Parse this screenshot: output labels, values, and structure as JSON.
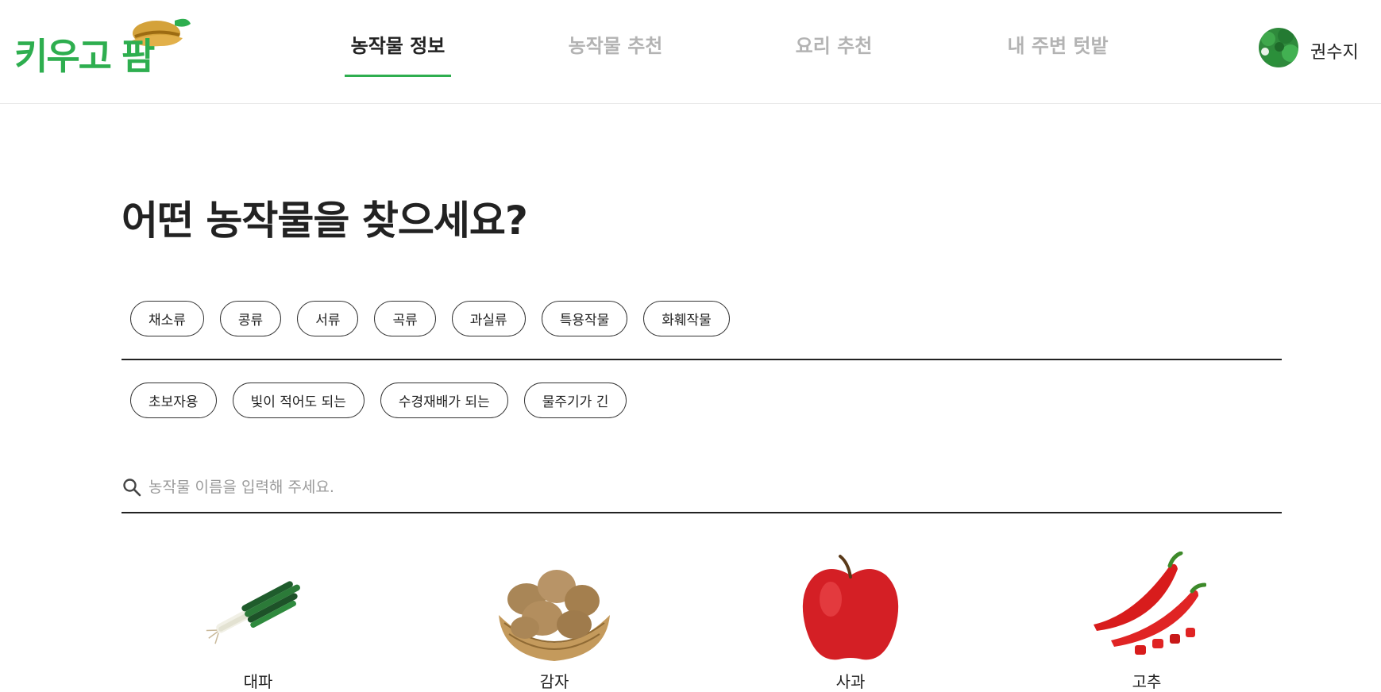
{
  "header": {
    "logo_text": "키우고 팜",
    "nav": [
      {
        "label": "농작물 정보",
        "active": true
      },
      {
        "label": "농작물 추천",
        "active": false
      },
      {
        "label": "요리 추천",
        "active": false
      },
      {
        "label": "내 주변 텃밭",
        "active": false
      }
    ],
    "user_name": "권수지"
  },
  "main": {
    "title": "어떤 농작물을 찾으세요?",
    "category_chips": [
      "채소류",
      "콩류",
      "서류",
      "곡류",
      "과실류",
      "특용작물",
      "화훼작물"
    ],
    "feature_chips": [
      "초보자용",
      "빛이 적어도 되는",
      "수경재배가 되는",
      "물주기가 긴"
    ],
    "search": {
      "placeholder": "농작물 이름을 입력해 주세요.",
      "value": ""
    },
    "crops": [
      {
        "name": "대파",
        "icon": "green-onion-icon"
      },
      {
        "name": "감자",
        "icon": "potato-icon"
      },
      {
        "name": "사과",
        "icon": "apple-icon"
      },
      {
        "name": "고추",
        "icon": "chili-pepper-icon"
      }
    ]
  },
  "colors": {
    "brand": "#2eae4f",
    "hat": "#d4a23a",
    "text": "#222222",
    "muted": "#b3b3b3"
  }
}
